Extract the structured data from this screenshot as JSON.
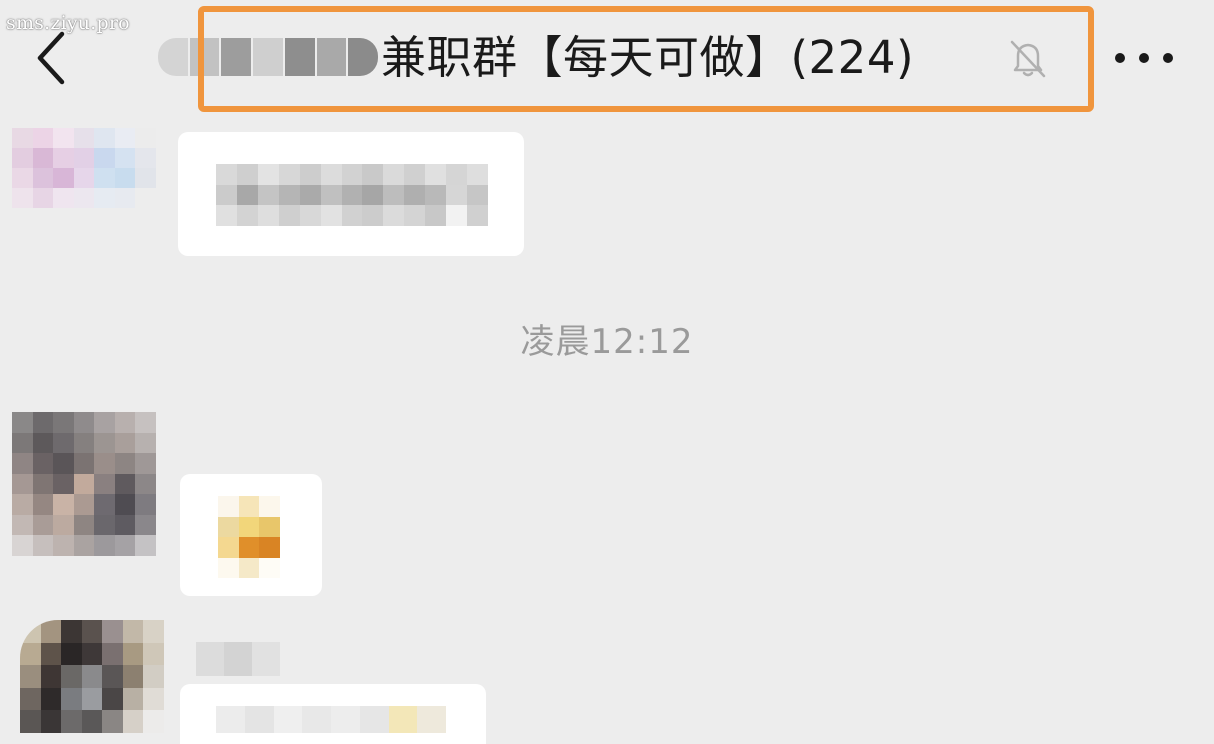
{
  "watermark": "sms.ziyu.pro",
  "header": {
    "title": "兼职群【每天可做】(224)",
    "icons": {
      "back": "chevron-left-icon",
      "mute": "bell-off-icon",
      "more": "more-dots-icon"
    }
  },
  "chat": {
    "timestamp": "凌晨12:12"
  },
  "colors": {
    "background": "#ededed",
    "highlight_border": "#f0953d",
    "bubble": "#ffffff",
    "timestamp_text": "#9a9a9a"
  }
}
